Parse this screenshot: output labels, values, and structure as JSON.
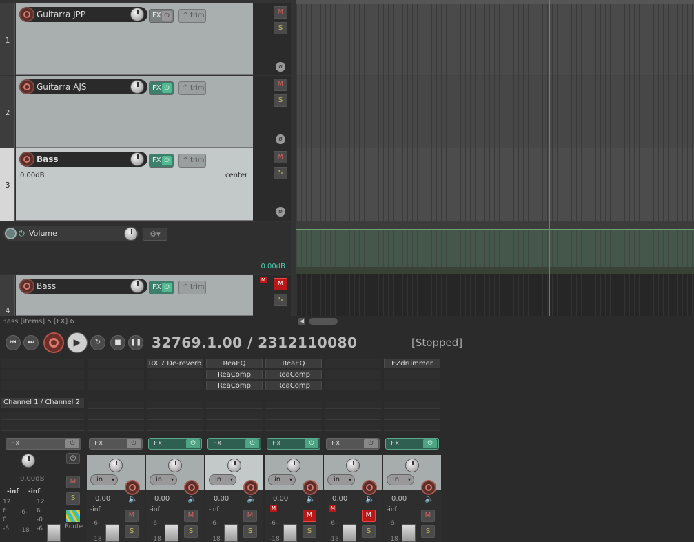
{
  "tracks": [
    {
      "number": "1",
      "name": "Guitarra JPP",
      "fx_label": "FX",
      "trim_label": "trim",
      "mute": "M",
      "solo": "S",
      "phase": "ø"
    },
    {
      "number": "2",
      "name": "Guitarra AJS",
      "fx_label": "FX",
      "trim_label": "trim",
      "mute": "M",
      "solo": "S",
      "phase": "ø"
    },
    {
      "number": "3",
      "name": "Bass",
      "fx_label": "FX",
      "trim_label": "trim",
      "mute": "M",
      "solo": "S",
      "phase": "ø",
      "volume": "0.00dB",
      "pan": "center"
    },
    {
      "number": "4",
      "name": "Bass",
      "fx_label": "FX",
      "trim_label": "trim",
      "mute": "M",
      "solo": "S",
      "mini_mute": "M"
    }
  ],
  "envelope": {
    "name": "Volume",
    "value": "0.00dB"
  },
  "status_line": "Bass [items] 5 [FX] 6",
  "transport": {
    "position": "32769.1.00 / 2312110080",
    "state": "[Stopped]"
  },
  "mixer": {
    "master": {
      "channel_label": "Channel 1 / Channel 2",
      "fx_label": "FX",
      "db": "0.00dB",
      "inf_left": "-inf",
      "inf_right": "-inf",
      "scale_left": [
        "12",
        "6",
        "0",
        "-6"
      ],
      "scale_right": [
        "12",
        "6",
        "-0",
        "-6"
      ],
      "scale_mid": [
        "-6-",
        "-18-"
      ],
      "mute": "M",
      "solo": "S",
      "route_label": "Route"
    },
    "strips": [
      {
        "fx_slots": [],
        "fx_label": "FX",
        "fx_on": false,
        "input": "in",
        "value": "0.00",
        "inf": "-inf",
        "mute": "M",
        "solo": "S",
        "mute_active": false,
        "scale": [
          "-6-",
          "-18-"
        ]
      },
      {
        "fx_slots": [
          "RX 7 De-reverb"
        ],
        "fx_label": "FX",
        "fx_on": true,
        "input": "in",
        "value": "0.00",
        "inf": "-inf",
        "mute": "M",
        "solo": "S",
        "mute_active": false,
        "scale": [
          "-6-",
          "-18-"
        ]
      },
      {
        "fx_slots": [
          "ReaEQ",
          "ReaComp",
          "ReaComp"
        ],
        "fx_label": "FX",
        "fx_on": true,
        "input": "in",
        "value": "0.00",
        "inf": "-inf",
        "mute": "M",
        "solo": "S",
        "mute_active": false,
        "scale": [
          "-6-",
          "-18-"
        ]
      },
      {
        "fx_slots": [
          "ReaEQ",
          "ReaComp",
          "ReaComp"
        ],
        "fx_label": "FX",
        "fx_on": true,
        "input": "in",
        "value": "0.00",
        "inf": "",
        "mute": "M",
        "solo": "S",
        "mute_active": true,
        "mini_mute": "M",
        "scale": [
          "-6-",
          "-18-"
        ]
      },
      {
        "fx_slots": [],
        "fx_label": "FX",
        "fx_on": false,
        "input": "in",
        "value": "0.00",
        "inf": "",
        "mute": "M",
        "solo": "S",
        "mute_active": true,
        "mini_mute": "M",
        "scale": [
          "-6-",
          "-18-"
        ]
      },
      {
        "fx_slots": [
          "EZdrummer"
        ],
        "fx_label": "FX",
        "fx_on": true,
        "input": "in",
        "value": "0.00",
        "inf": "-inf",
        "mute": "M",
        "solo": "S",
        "mute_active": false,
        "scale": [
          "-6-",
          "-18-"
        ]
      }
    ]
  },
  "colors": {
    "accent": "#3c7f6a",
    "mute_active": "#b81818",
    "cursor": "#1fa38a"
  }
}
